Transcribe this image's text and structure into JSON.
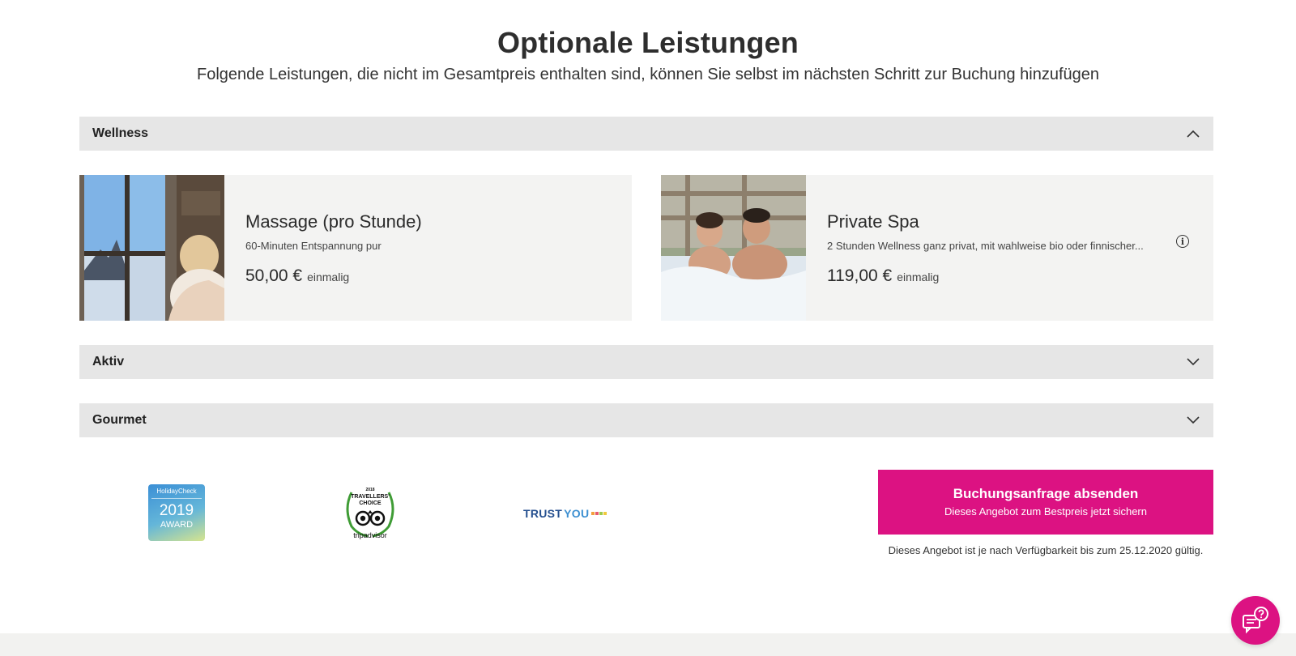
{
  "header": {
    "title": "Optionale Leistungen",
    "subtitle": "Folgende Leistungen, die nicht im Gesamtpreis enthalten sind, können Sie selbst im nächsten Schritt zur Buchung hinzufügen"
  },
  "sections": [
    {
      "label": "Wellness",
      "expanded": true
    },
    {
      "label": "Aktiv",
      "expanded": false
    },
    {
      "label": "Gourmet",
      "expanded": false
    }
  ],
  "wellness_items": [
    {
      "title": "Massage (pro Stunde)",
      "description": "60-Minuten Entspannung pur",
      "price": "50,00 €",
      "frequency": "einmalig"
    },
    {
      "title": "Private Spa",
      "description": "2 Stunden Wellness ganz privat, mit wahlweise bio oder finnischer...",
      "price": "119,00 €",
      "frequency": "einmalig"
    }
  ],
  "badges": {
    "holidaycheck": {
      "brand": "HolidayCheck",
      "year": "2019",
      "award": "AWARD"
    },
    "tripadvisor": {
      "year": "2018",
      "choice": "TRAVELLERS' CHOICE",
      "brand": "tripadvisor"
    },
    "trustyou": {
      "trust": "TRUST",
      "you": "YOU"
    }
  },
  "cta": {
    "main": "Buchungsanfrage absenden",
    "sub": "Dieses Angebot zum Bestpreis jetzt sichern"
  },
  "validity_note": "Dieses Angebot ist je nach Verfügbarkeit bis zum 25.12.2020 gültig.",
  "colors": {
    "accent": "#dc1282",
    "section_bg": "#e6e6e6",
    "card_bg": "#f3f3f2"
  },
  "icons": {
    "expanded": "chevron-up-icon",
    "collapsed": "chevron-down-icon",
    "info": "info-icon",
    "help": "help-chat-icon"
  }
}
